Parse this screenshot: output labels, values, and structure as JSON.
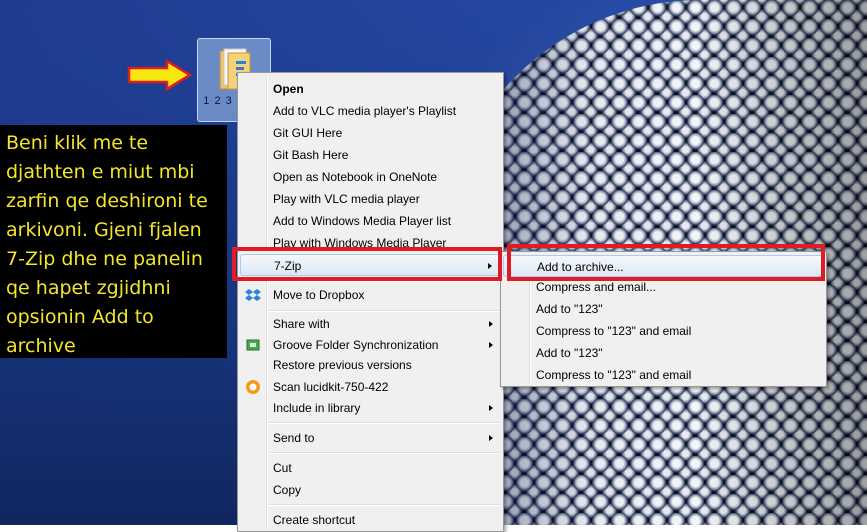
{
  "desktop": {
    "folder_label": "1 2 3"
  },
  "instructions": {
    "text": "Beni klik me te djathten e miut mbi zarfin qe deshironi te arkivoni. Gjeni fjalen 7-Zip dhe ne panelin qe hapet zgjidhni opsionin Add to archive"
  },
  "context_menu": {
    "items": [
      {
        "label": "Open"
      },
      {
        "label": "Add to VLC media player's Playlist"
      },
      {
        "label": "Git GUI Here"
      },
      {
        "label": "Git Bash Here"
      },
      {
        "label": "Open as Notebook in OneNote"
      },
      {
        "label": "Play with VLC media player"
      },
      {
        "label": "Add to Windows Media Player list"
      },
      {
        "label": "Play with Windows Media Player"
      },
      {
        "label": "7-Zip"
      },
      {
        "label": "Move to Dropbox"
      },
      {
        "label": "Share with"
      },
      {
        "label": "Groove Folder Synchronization"
      },
      {
        "label": "Restore previous versions"
      },
      {
        "label": "Scan lucidkit-750-422"
      },
      {
        "label": "Include in library"
      },
      {
        "label": "Send to"
      },
      {
        "label": "Cut"
      },
      {
        "label": "Copy"
      },
      {
        "label": "Create shortcut"
      }
    ]
  },
  "submenu_7zip": {
    "items": [
      {
        "label": "Add to archive..."
      },
      {
        "label": "Compress and email..."
      },
      {
        "label": "Add to \"123\""
      },
      {
        "label": "Compress to \"123\" and email"
      },
      {
        "label": "Add to \"123\""
      },
      {
        "label": "Compress to \"123\" and email"
      }
    ]
  },
  "colors": {
    "highlight": "#e01b24",
    "arrow": "#f6e711",
    "instruction_text": "#f2e52a"
  },
  "icons": {
    "folder": "folder-icon",
    "dropbox": "dropbox-icon",
    "groove": "groove-icon",
    "scan": "scan-icon",
    "arrow": "yellow-arrow-icon"
  }
}
